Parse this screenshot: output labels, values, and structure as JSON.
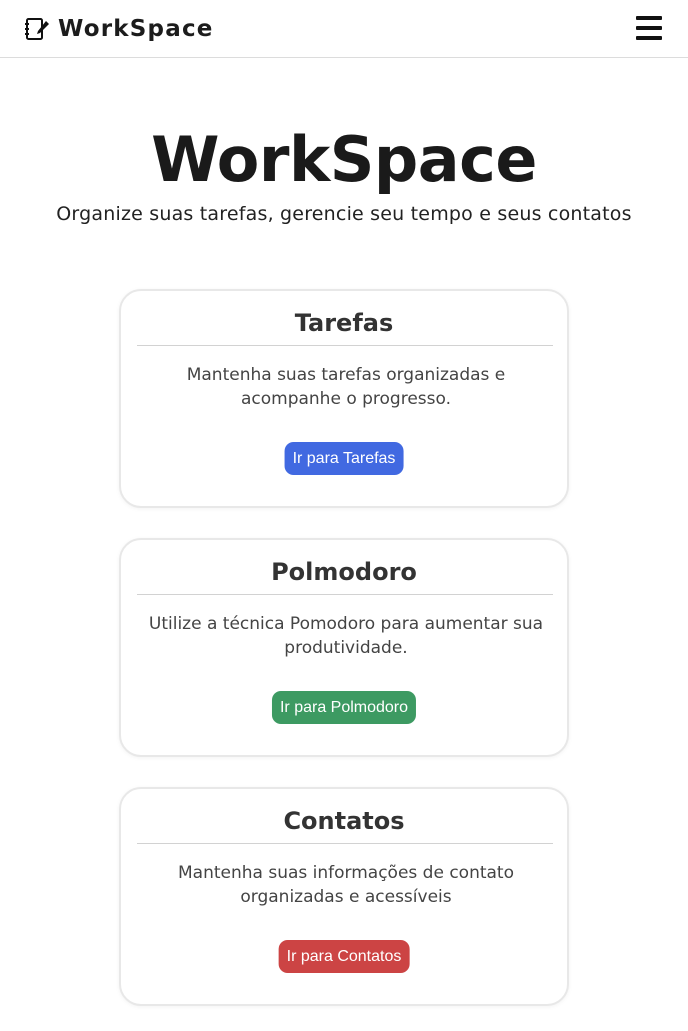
{
  "navbar": {
    "brand_text": "WorkSpace",
    "brand_icon": "notebook-pen-icon",
    "menu_icon": "hamburger-menu-icon"
  },
  "hero": {
    "title": "WorkSpace",
    "subtitle": "Organize suas tarefas, gerencie seu tempo e seus contatos"
  },
  "cards": [
    {
      "title": "Tarefas",
      "description": "Mantenha suas tarefas organizadas e acompanhe o progresso.",
      "button_label": "Ir para Tarefas",
      "button_color": "#4169e1"
    },
    {
      "title": "Polmodoro",
      "description": "Utilize a técnica Pomodoro para aumentar sua produtividade.",
      "button_label": "Ir para Polmodoro",
      "button_color": "#3d9a62"
    },
    {
      "title": "Contatos",
      "description": "Mantenha suas informações de contato organizadas e acessíveis",
      "button_label": "Ir para Contatos",
      "button_color": "#cc4444"
    }
  ]
}
